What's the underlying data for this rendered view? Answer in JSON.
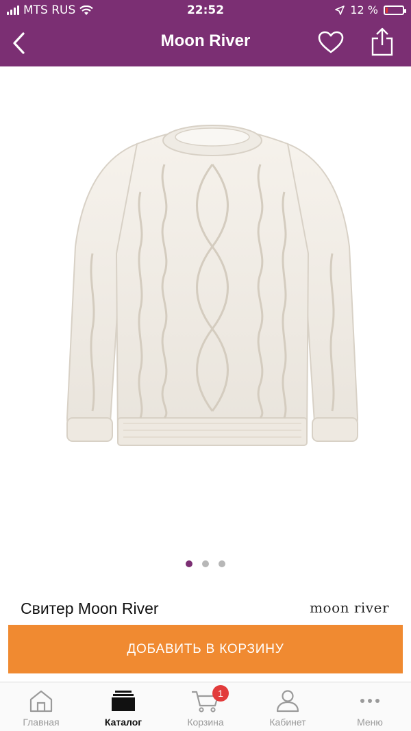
{
  "status_bar": {
    "carrier": "MTS RUS",
    "time": "22:52",
    "battery_percent": "12 %",
    "battery_level": 0.12
  },
  "header": {
    "title": "Moon River",
    "background_color": "#7b2f73"
  },
  "gallery": {
    "image_count": 3,
    "active_index": 0
  },
  "product": {
    "title": "Свитер Moon River",
    "brand_logo": "moon river"
  },
  "actions": {
    "add_to_cart_label": "ДОБАВИТЬ В КОРЗИНУ",
    "button_color": "#f08a31"
  },
  "tab_bar": {
    "items": [
      {
        "label": "Главная",
        "icon": "home-icon"
      },
      {
        "label": "Каталог",
        "icon": "catalog-icon",
        "active": true
      },
      {
        "label": "Корзина",
        "icon": "cart-icon",
        "badge": "1"
      },
      {
        "label": "Кабинет",
        "icon": "user-icon"
      },
      {
        "label": "Меню",
        "icon": "more-icon"
      }
    ]
  }
}
